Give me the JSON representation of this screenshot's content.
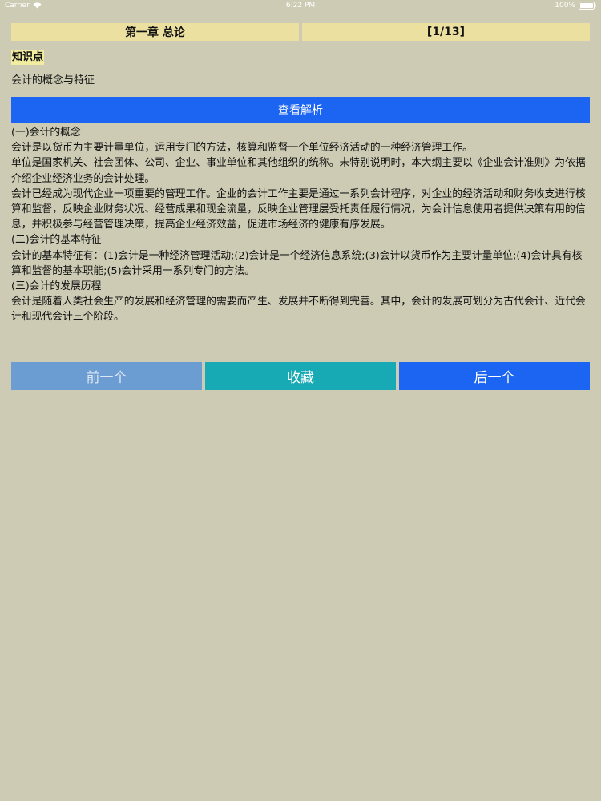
{
  "status_bar": {
    "carrier": "Carrier",
    "time": "6:22 PM",
    "battery": "100%"
  },
  "header": {
    "chapter": "第一章 总论",
    "progress": "[1/13]"
  },
  "knowledge_point": {
    "label": "知识点",
    "title": "会计的概念与特征"
  },
  "analysis_button_label": "查看解析",
  "content": [
    "(一)会计的概念",
    "会计是以货币为主要计量单位，运用专门的方法，核算和监督一个单位经济活动的一种经济管理工作。",
    "单位是国家机关、社会团体、公司、企业、事业单位和其他组织的统称。未特别说明时，本大纲主要以《企业会计准则》为依据介绍企业经济业务的会计处理。",
    "会计已经成为现代企业一项重要的管理工作。企业的会计工作主要是通过一系列会计程序，对企业的经济活动和财务收支进行核算和监督，反映企业财务状况、经营成果和现金流量，反映企业管理层受托责任履行情况，为会计信息使用者提供决策有用的信息，并积极参与经营管理决策，提高企业经济效益，促进市场经济的健康有序发展。",
    "(二)会计的基本特征",
    "会计的基本特征有：(1)会计是一种经济管理活动;(2)会计是一个经济信息系统;(3)会计以货币作为主要计量单位;(4)会计具有核算和监督的基本职能;(5)会计采用一系列专门的方法。",
    "(三)会计的发展历程",
    "会计是随着人类社会生产的发展和经济管理的需要而产生、发展并不断得到完善。其中，会计的发展可划分为古代会计、近代会计和现代会计三个阶段。"
  ],
  "nav": {
    "prev_label": "前一个",
    "favorite_label": "收藏",
    "next_label": "后一个"
  },
  "colors": {
    "background": "#cdcbb4",
    "header": "#ece0a0",
    "primary_blue": "#1c64f2",
    "prev_disabled": "#6b9cd2",
    "favorite_teal": "#17aab4"
  }
}
